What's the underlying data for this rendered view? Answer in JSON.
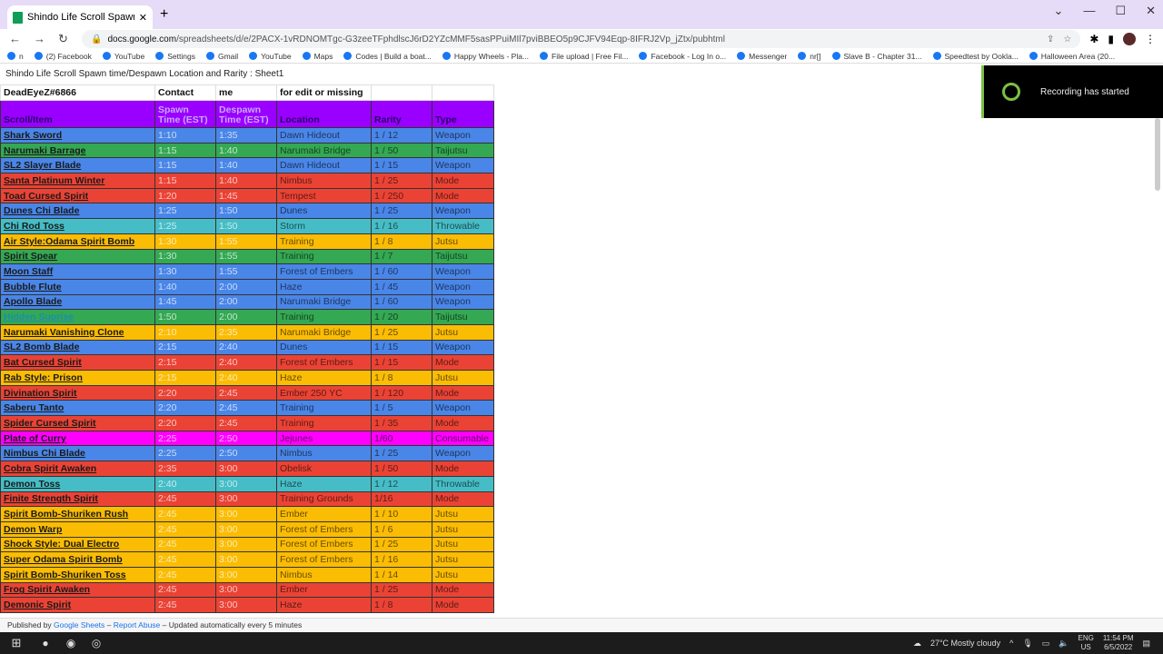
{
  "browser": {
    "tab_title": "Shindo Life Scroll Spawn time/De",
    "url_host": "docs.google.com",
    "url_path": "/spreadsheets/d/e/2PACX-1vRDNOMTgc-G3zeeTFphdlscJ6rD2YZcMMF5sasPPuiMIl7pviBBEO5p9CJFV94Eqp-8IFRJ2Vp_jZtx/pubhtml",
    "bookmarks": [
      "n",
      "(2) Facebook",
      "YouTube",
      "Settings",
      "Gmail",
      "YouTube",
      "Maps",
      "Codes | Build a boat...",
      "Happy Wheels - Pla...",
      "File upload | Free Fil...",
      "Facebook - Log In o...",
      "Messenger",
      "nr[]",
      "Slave B - Chapter 31...",
      "Speedtest by Ookla...",
      "Halloween Area (20..."
    ]
  },
  "doc_title": "Shindo Life Scroll Spawn time/Despawn Location and Rarity : Sheet1",
  "top_row": [
    "DeadEyeZ#6866",
    "Contact",
    "me",
    "for edit or missing",
    "",
    ""
  ],
  "headers": {
    "name": "Scroll/Item",
    "spawn_1": "Spawn",
    "spawn_2": "Time (EST)",
    "despawn_1": "Despawn",
    "despawn_2": "Time (EST)",
    "location": "Location",
    "rarity": "Rarity",
    "type": "Type"
  },
  "colors": {
    "Weapon": "#4a86e8",
    "Taijutsu": "#34a853",
    "Mode": "#ea4335",
    "Throwable": "#46bdc6",
    "Jutsu": "#fbbc04",
    "Consumable": "#ff00ff",
    "header": "#9900ff"
  },
  "rows": [
    [
      "Shark Sword",
      "1:10",
      "1:35",
      "Dawn Hideout",
      "1 / 12",
      "Weapon"
    ],
    [
      "Narumaki Barrage",
      "1:15",
      "1:40",
      "Narumaki Bridge",
      "1 / 50",
      "Taijutsu"
    ],
    [
      "SL2 Slayer Blade",
      "1:15",
      "1:40",
      "Dawn Hideout",
      "1 / 15",
      "Weapon"
    ],
    [
      "Santa Platinum Winter",
      "1:15",
      "1:40",
      "Nimbus",
      "1 / 25",
      "Mode"
    ],
    [
      "Toad Cursed Spirit",
      "1:20",
      "1:45",
      "Tempest",
      "1 / 250",
      "Mode"
    ],
    [
      "Dunes Chi Blade",
      "1:25",
      "1:50",
      "Dunes",
      "1 / 25",
      "Weapon"
    ],
    [
      "Chi Rod Toss",
      "1:25",
      "1:50",
      "Storm",
      "1 / 16",
      "Throwable"
    ],
    [
      "Air Style:Odama Spirit Bomb",
      "1:30",
      "1:55",
      "Training",
      "1 / 8",
      "Jutsu"
    ],
    [
      "Spirit Spear",
      "1:30",
      "1:55",
      "Training",
      "1 / 7",
      "Taijutsu"
    ],
    [
      "Moon Staff",
      "1:30",
      "1:55",
      "Forest of Embers",
      "1 / 60",
      "Weapon"
    ],
    [
      "Bubble Flute",
      "1:40",
      "2:00",
      "Haze",
      "1 / 45",
      "Weapon"
    ],
    [
      "Apollo Blade",
      "1:45",
      "2:00",
      "Narumaki Bridge",
      "1 / 60",
      "Weapon"
    ],
    [
      "Hidden Suprise",
      "1:50",
      "2:00",
      "Training",
      "1 / 20",
      "Taijutsu"
    ],
    [
      "Narumaki Vanishing Clone",
      "2:10",
      "2:35",
      "Narumaki Bridge",
      "1 / 25",
      "Jutsu"
    ],
    [
      "SL2 Bomb Blade",
      "2:15",
      "2:40",
      "Dunes",
      "1 / 15",
      "Weapon"
    ],
    [
      "Bat Cursed Spirit",
      "2:15",
      "2:40",
      "Forest of Embers",
      "1 / 15",
      "Mode"
    ],
    [
      "Rab Style: Prison",
      "2:15",
      "2:40",
      "Haze",
      "1 / 8",
      "Jutsu"
    ],
    [
      "Divination Spirit",
      "2:20",
      "2:45",
      "Ember 250 YC",
      "1 / 120",
      "Mode"
    ],
    [
      "Saberu Tanto",
      "2:20",
      "2:45",
      "Training",
      "1 / 5",
      "Weapon"
    ],
    [
      "Spider Cursed Spirit",
      "2:20",
      "2:45",
      "Training",
      "1 / 35",
      "Mode"
    ],
    [
      "Plate of Curry",
      "2:25",
      "2:50",
      "Jejunes",
      "1/60",
      "Consumable"
    ],
    [
      "Nimbus Chi Blade",
      "2:25",
      "2:50",
      "Nimbus",
      "1 / 25",
      "Weapon"
    ],
    [
      "Cobra Spirit Awaken",
      "2:35",
      "3:00",
      "Obelisk",
      "1 / 50",
      "Mode"
    ],
    [
      "Demon Toss",
      "2:40",
      "3:00",
      "Haze",
      "1 / 12",
      "Throwable"
    ],
    [
      "Finite Strength Spirit",
      "2:45",
      "3:00",
      "Training Grounds",
      "1/16",
      "Mode"
    ],
    [
      "Spirit Bomb-Shuriken Rush",
      "2:45",
      "3:00",
      "Ember",
      "1 / 10",
      "Jutsu"
    ],
    [
      "Demon Warp",
      "2:45",
      "3:00",
      "Forest of Embers",
      "1 / 6",
      "Jutsu"
    ],
    [
      "Shock Style: Dual Electro",
      "2:45",
      "3:00",
      "Forest of Embers",
      "1 / 25",
      "Jutsu"
    ],
    [
      "Super Odama Spirit Bomb",
      "2:45",
      "3:00",
      "Forest of Embers",
      "1 / 16",
      "Jutsu"
    ],
    [
      "Spirit Bomb-Shuriken Toss",
      "2:45",
      "3:00",
      "Nimbus",
      "1 / 14",
      "Jutsu"
    ],
    [
      "Frog Spirit Awaken",
      "2:45",
      "3:00",
      "Ember",
      "1 / 25",
      "Mode"
    ],
    [
      "Demonic Spirit",
      "2:45",
      "3:00",
      "Haze",
      "1 / 8",
      "Mode"
    ]
  ],
  "footer": {
    "published_by": "Published by",
    "google_sheets": "Google Sheets",
    "sep1": "–",
    "report_abuse": "Report Abuse",
    "sep2": "–",
    "updated": "Updated automatically every 5 minutes"
  },
  "recording": "Recording has started",
  "taskbar": {
    "weather": "27°C  Mostly cloudy",
    "lang1": "ENG",
    "lang2": "US",
    "time": "11:54 PM",
    "date": "6/5/2022"
  }
}
